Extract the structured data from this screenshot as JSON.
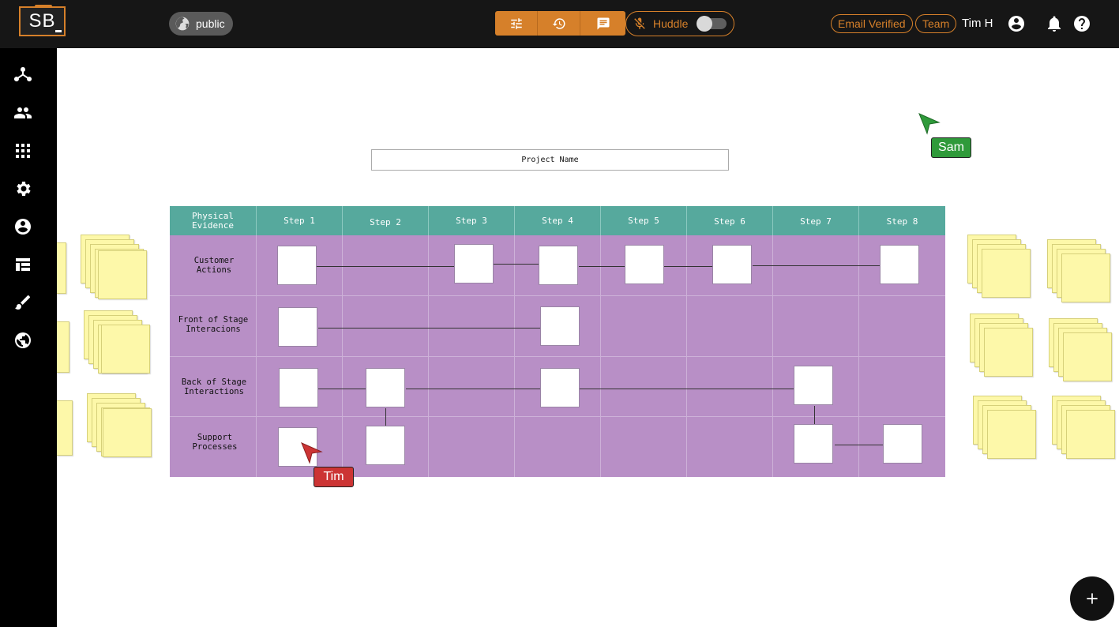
{
  "header": {
    "logo_text": "SB",
    "visibility_label": "public",
    "toolbar": {
      "icons": [
        "sliders-icon",
        "history-icon",
        "chat-icon"
      ]
    },
    "huddle_label": "Huddle",
    "huddle_enabled": false,
    "email_chip": "Email Verified",
    "team_chip": "Team",
    "user_name": "Tim H"
  },
  "sidebar": {
    "icons": [
      "network-icon",
      "people-icon",
      "apps-grid-icon",
      "settings-icon",
      "account-icon",
      "table-icon",
      "brush-icon",
      "globe-icon"
    ]
  },
  "canvas": {
    "project_name": "Project Name",
    "columns": [
      "Physical Evidence",
      "Step 1",
      "Step 2",
      "Step 3",
      "Step 4",
      "Step 5",
      "Step 6",
      "Step 7",
      "Step 8"
    ],
    "lanes": [
      "Customer Actions",
      "Front of Stage Interacions",
      "Back of Stage Interactions",
      "Support Processes"
    ],
    "cursors": [
      {
        "name": "Sam",
        "color": "#2f9a3a"
      },
      {
        "name": "Tim",
        "color": "#cc3434"
      }
    ]
  },
  "colors": {
    "accent": "#d6802a",
    "header_teal": "#56a99d",
    "lane_purple": "#b88fc6",
    "sticky_yellow": "#fdf8a9"
  }
}
